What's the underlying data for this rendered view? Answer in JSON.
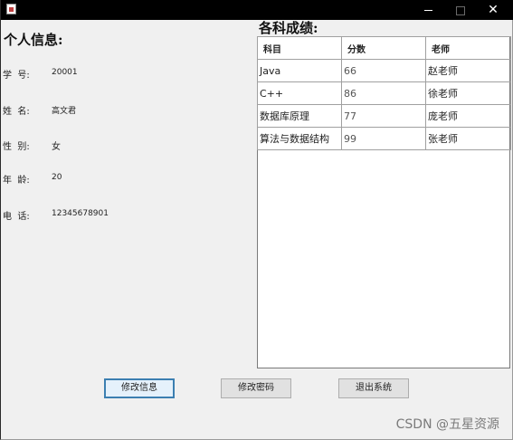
{
  "titlebar": {
    "minimize": "−",
    "maximize": "□",
    "close": "✕"
  },
  "personal_info": {
    "title": "个人信息:",
    "fields": [
      {
        "label": "学  号:",
        "value": "20001"
      },
      {
        "label": "姓  名:",
        "value": "高文君"
      },
      {
        "label": "性  别:",
        "value": "女"
      },
      {
        "label": "年  龄:",
        "value": "20"
      },
      {
        "label": "电  话:",
        "value": "12345678901"
      }
    ]
  },
  "grades": {
    "title": "各科成绩:",
    "headers": [
      "科目",
      "分数",
      "老师"
    ],
    "rows": [
      [
        "Java",
        "66",
        "赵老师"
      ],
      [
        "C++",
        "86",
        "徐老师"
      ],
      [
        "数据库原理",
        "77",
        "庞老师"
      ],
      [
        "算法与数据结构",
        "99",
        "张老师"
      ]
    ]
  },
  "buttons": {
    "edit_info": "修改信息",
    "change_password": "修改密码",
    "exit_system": "退出系统"
  },
  "watermark": "CSDN @五星资源"
}
